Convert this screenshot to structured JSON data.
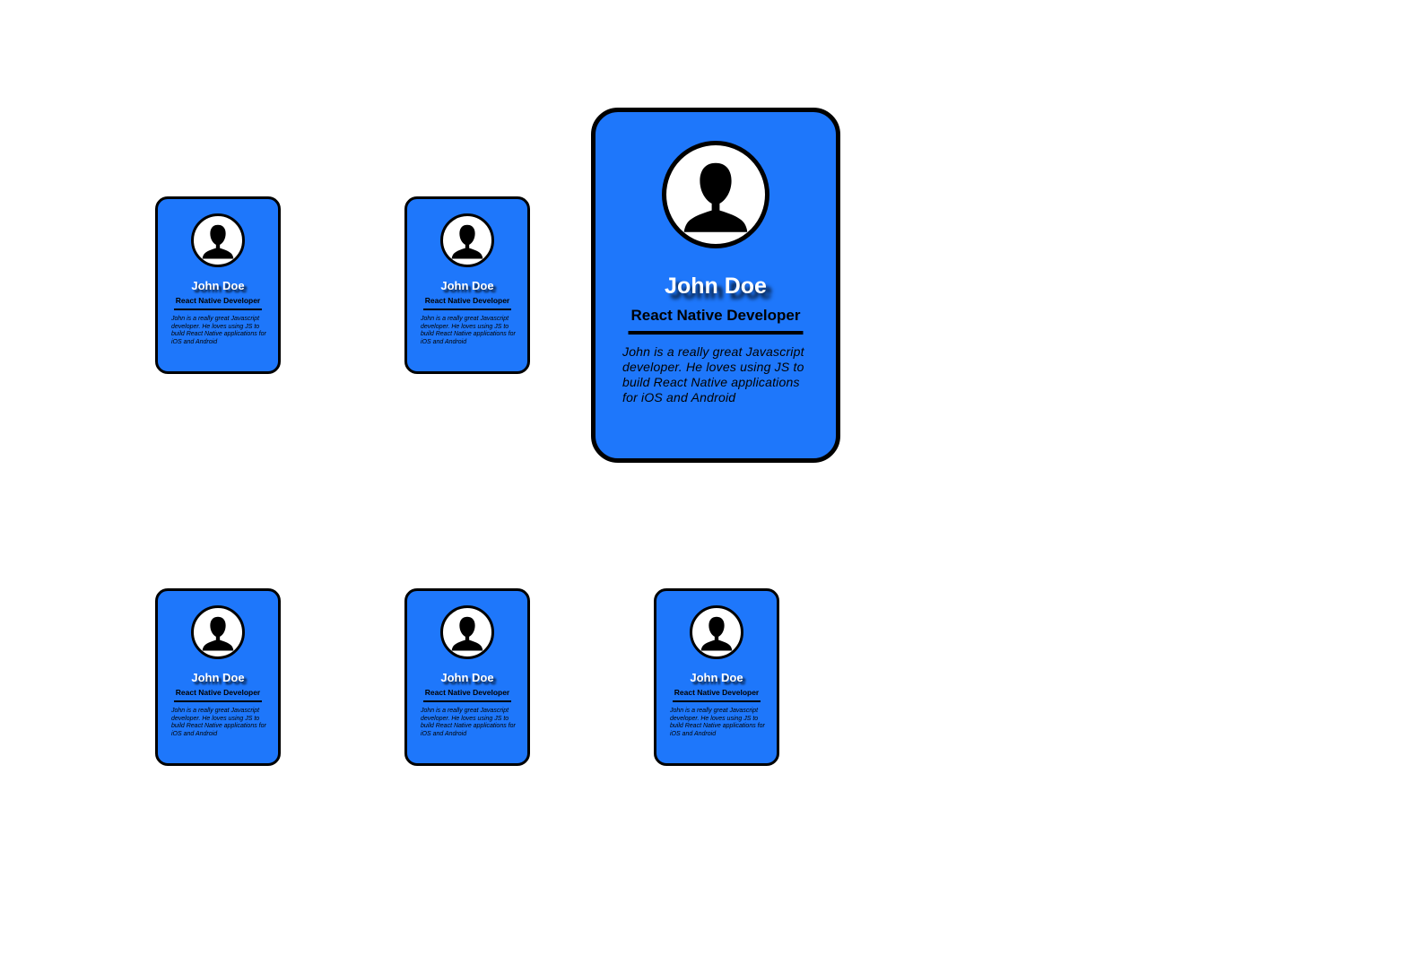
{
  "profile": {
    "name": "John Doe",
    "role": "React Native Developer",
    "bio": "John is a really great Javascript developer. He loves using JS to build React Native applications for iOS and Android",
    "avatar_icon": "user-silhouette-icon"
  },
  "colors": {
    "card_background": "#1e77fb",
    "border": "#000000",
    "name_text": "#ffffff",
    "page_background": "#ffffff"
  }
}
